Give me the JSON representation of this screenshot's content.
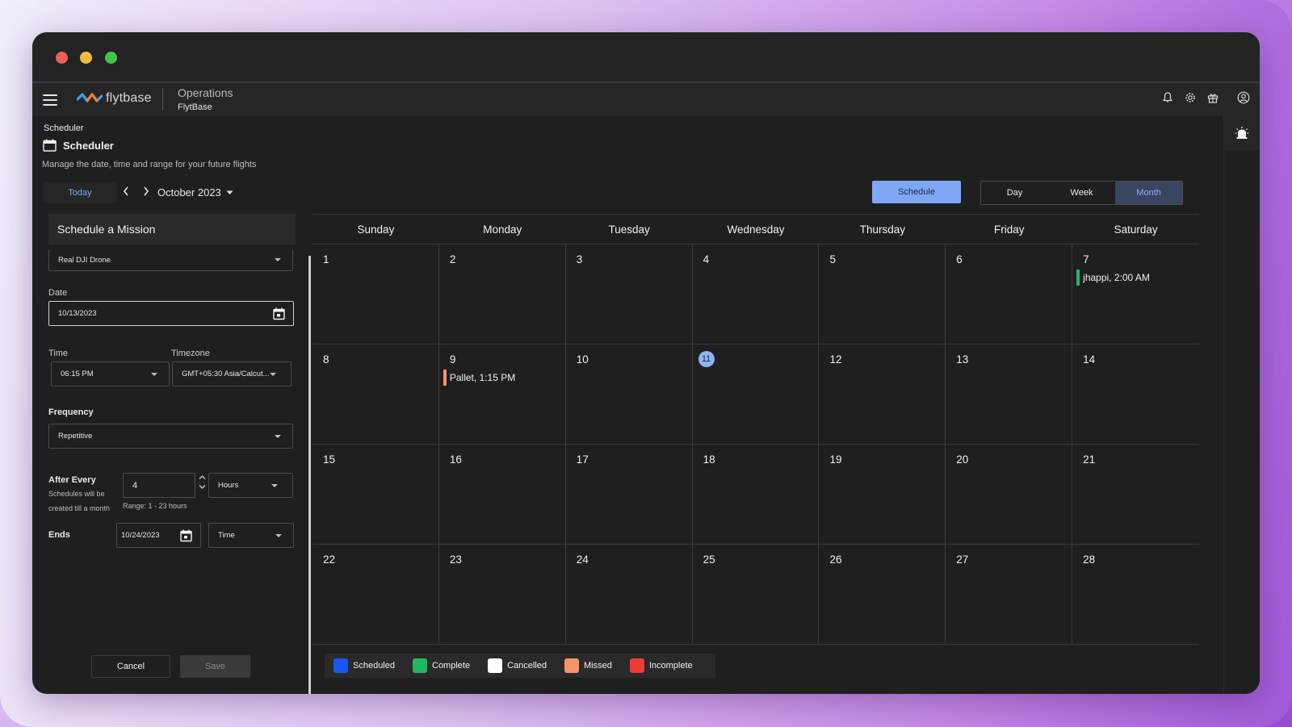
{
  "app": {
    "brand": "flytbase",
    "title": "Operations",
    "subtitle": "FlytBase"
  },
  "page": {
    "breadcrumb": "Scheduler",
    "title": "Scheduler",
    "description": "Manage the date, time and range for your future flights"
  },
  "toolbar": {
    "today_label": "Today",
    "month_label": "October 2023",
    "schedule_label": "Schedule",
    "views": [
      "Day",
      "Week",
      "Month"
    ],
    "active_view": "Month"
  },
  "form": {
    "heading": "Schedule a Mission",
    "drone_value": "Real DJI Drone",
    "date_label": "Date",
    "date_value": "10/13/2023",
    "time_label": "Time",
    "time_value": "06:15 PM",
    "timezone_label": "Timezone",
    "timezone_value": "GMT+05:30 Asia/Calcut...",
    "frequency_label": "Frequency",
    "frequency_value": "Repetitive",
    "after_every_label": "After Every",
    "after_every_note": "Schedules will be created till a month",
    "interval_value": "4",
    "interval_unit": "Hours",
    "range_note": "Range: 1 - 23 hours",
    "ends_label": "Ends",
    "ends_date": "10/24/2023",
    "ends_type": "Time",
    "cancel_label": "Cancel",
    "save_label": "Save"
  },
  "calendar": {
    "weekdays": [
      "Sunday",
      "Monday",
      "Tuesday",
      "Wednesday",
      "Thursday",
      "Friday",
      "Saturday"
    ],
    "weeks": [
      [
        {
          "d": "1"
        },
        {
          "d": "2"
        },
        {
          "d": "3"
        },
        {
          "d": "4"
        },
        {
          "d": "5"
        },
        {
          "d": "6"
        },
        {
          "d": "7",
          "event": "jhappi, 2:00 AM",
          "status": "complete"
        }
      ],
      [
        {
          "d": "8"
        },
        {
          "d": "9",
          "event": "Pallet, 1:15 PM",
          "status": "missed"
        },
        {
          "d": "10"
        },
        {
          "d": "11",
          "today": true
        },
        {
          "d": "12"
        },
        {
          "d": "13"
        },
        {
          "d": "14"
        }
      ],
      [
        {
          "d": "15"
        },
        {
          "d": "16"
        },
        {
          "d": "17"
        },
        {
          "d": "18"
        },
        {
          "d": "19"
        },
        {
          "d": "20"
        },
        {
          "d": "21"
        }
      ],
      [
        {
          "d": "22"
        },
        {
          "d": "23"
        },
        {
          "d": "24"
        },
        {
          "d": "25"
        },
        {
          "d": "26"
        },
        {
          "d": "27"
        },
        {
          "d": "28"
        }
      ]
    ]
  },
  "legend": [
    {
      "label": "Scheduled",
      "color": "#1a56f0"
    },
    {
      "label": "Complete",
      "color": "#22b862"
    },
    {
      "label": "Cancelled",
      "color": "#ffffff"
    },
    {
      "label": "Missed",
      "color": "#f5966a"
    },
    {
      "label": "Incomplete",
      "color": "#f03a36"
    }
  ],
  "status_colors": {
    "complete": "#22b862",
    "missed": "#f5966a"
  },
  "icons": [
    "hamburger-icon",
    "bell-icon",
    "gear-icon",
    "gift-icon",
    "user-circle-icon",
    "siren-icon",
    "calendar-icon",
    "chevron-left-icon",
    "chevron-right-icon",
    "caret-down-icon"
  ]
}
